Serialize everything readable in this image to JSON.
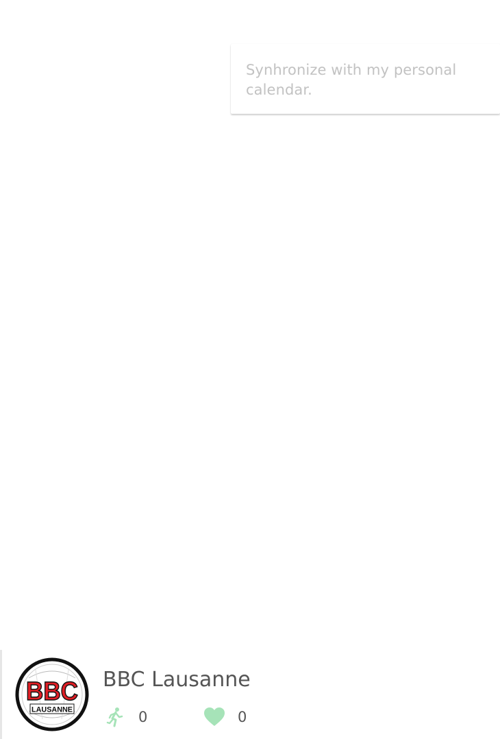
{
  "sync_card": {
    "text": "Synhronize with my personal calendar."
  },
  "club": {
    "name": "BBC Lausanne",
    "logo_text_main": "BBC",
    "logo_text_sub": "LAUSANNE",
    "players_count": "0",
    "likes_count": "0",
    "icons": {
      "players": "running-person-icon",
      "likes": "heart-icon"
    },
    "colors": {
      "icon_green": "#a6e3b8",
      "logo_red": "#e01f26"
    }
  }
}
